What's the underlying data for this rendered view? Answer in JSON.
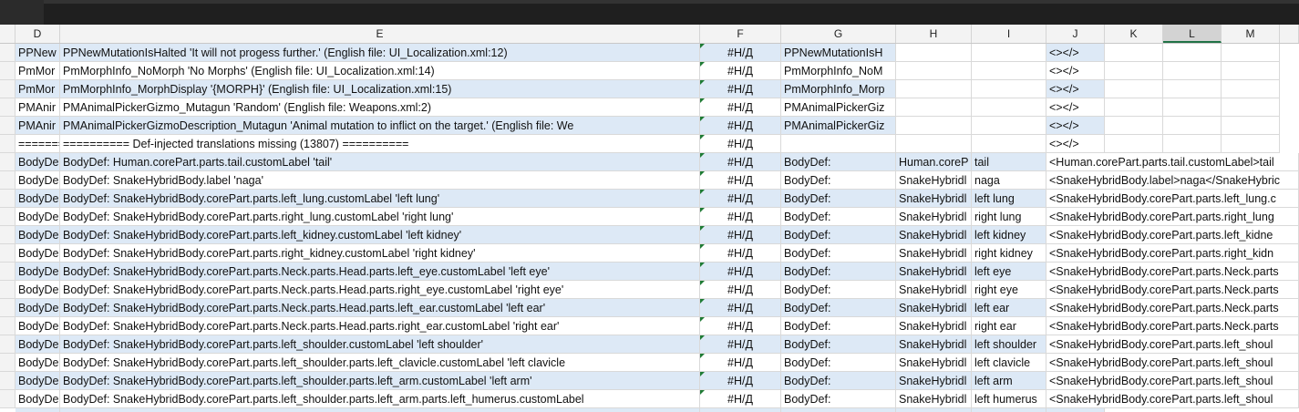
{
  "columns": [
    "D",
    "E",
    "F",
    "G",
    "H",
    "I",
    "J",
    "K",
    "L",
    "M"
  ],
  "selected_column": "L",
  "rows": [
    {
      "D": "PPNew",
      "E": "PPNewMutationIsHalted 'It will not progess further.' (English file: UI_Localization.xml:12)",
      "F": "#Н/Д",
      "G": "PPNewMutationIsH",
      "H": "",
      "I": "",
      "J": "<></>",
      "band": true
    },
    {
      "D": "PmMor",
      "E": "PmMorphInfo_NoMorph 'No Morphs' (English file: UI_Localization.xml:14)",
      "F": "#Н/Д",
      "G": "PmMorphInfo_NoM",
      "H": "",
      "I": "",
      "J": "<></>",
      "band": false
    },
    {
      "D": "PmMor",
      "E": "PmMorphInfo_MorphDisplay '{MORPH}' (English file: UI_Localization.xml:15)",
      "F": "#Н/Д",
      "G": "PmMorphInfo_Morp",
      "H": "",
      "I": "",
      "J": "<></>",
      "band": true
    },
    {
      "D": "PMAnir",
      "E": "PMAnimalPickerGizmo_Mutagun 'Random' (English file: Weapons.xml:2)",
      "F": "#Н/Д",
      "G": "PMAnimalPickerGiz",
      "H": "",
      "I": "",
      "J": "<></>",
      "band": false
    },
    {
      "D": "PMAnir",
      "E": "PMAnimalPickerGizmoDescription_Mutagun 'Animal mutation to inflict on the target.' (English file: We",
      "F": "#Н/Д",
      "G": "PMAnimalPickerGiz",
      "H": "",
      "I": "",
      "J": "<></>",
      "band": true
    },
    {
      "D": "=======",
      "E": "========== Def-injected translations missing (13807) ==========",
      "F": "#Н/Д",
      "G": "",
      "H": "",
      "I": "",
      "J": "<></>",
      "band": false
    },
    {
      "D": "BodyDe",
      "E": "BodyDef: Human.corePart.parts.tail.customLabel 'tail'",
      "F": "#Н/Д",
      "G": "BodyDef:",
      "H": "Human.coreP",
      "I": "tail",
      "J": "<Human.corePart.parts.tail.customLabel>tail",
      "band": true
    },
    {
      "D": "BodyDe",
      "E": "BodyDef: SnakeHybridBody.label 'naga'",
      "F": "#Н/Д",
      "G": "BodyDef:",
      "H": "SnakeHybridl",
      "I": "naga",
      "J": "<SnakeHybridBody.label>naga</SnakeHybric",
      "band": false
    },
    {
      "D": "BodyDe",
      "E": "BodyDef: SnakeHybridBody.corePart.parts.left_lung.customLabel 'left lung'",
      "F": "#Н/Д",
      "G": "BodyDef:",
      "H": "SnakeHybridl",
      "I": "left lung",
      "J": "<SnakeHybridBody.corePart.parts.left_lung.c",
      "band": true
    },
    {
      "D": "BodyDe",
      "E": "BodyDef: SnakeHybridBody.corePart.parts.right_lung.customLabel 'right lung'",
      "F": "#Н/Д",
      "G": "BodyDef:",
      "H": "SnakeHybridl",
      "I": "right lung",
      "J": "<SnakeHybridBody.corePart.parts.right_lung",
      "band": false
    },
    {
      "D": "BodyDe",
      "E": "BodyDef: SnakeHybridBody.corePart.parts.left_kidney.customLabel 'left kidney'",
      "F": "#Н/Д",
      "G": "BodyDef:",
      "H": "SnakeHybridl",
      "I": "left kidney",
      "J": "<SnakeHybridBody.corePart.parts.left_kidne",
      "band": true
    },
    {
      "D": "BodyDe",
      "E": "BodyDef: SnakeHybridBody.corePart.parts.right_kidney.customLabel 'right kidney'",
      "F": "#Н/Д",
      "G": "BodyDef:",
      "H": "SnakeHybridl",
      "I": "right kidney",
      "J": "<SnakeHybridBody.corePart.parts.right_kidn",
      "band": false
    },
    {
      "D": "BodyDe",
      "E": "BodyDef: SnakeHybridBody.corePart.parts.Neck.parts.Head.parts.left_eye.customLabel 'left eye'",
      "F": "#Н/Д",
      "G": "BodyDef:",
      "H": "SnakeHybridl",
      "I": "left eye",
      "J": "<SnakeHybridBody.corePart.parts.Neck.parts",
      "band": true
    },
    {
      "D": "BodyDe",
      "E": "BodyDef: SnakeHybridBody.corePart.parts.Neck.parts.Head.parts.right_eye.customLabel 'right eye'",
      "F": "#Н/Д",
      "G": "BodyDef:",
      "H": "SnakeHybridl",
      "I": "right eye",
      "J": "<SnakeHybridBody.corePart.parts.Neck.parts",
      "band": false
    },
    {
      "D": "BodyDe",
      "E": "BodyDef: SnakeHybridBody.corePart.parts.Neck.parts.Head.parts.left_ear.customLabel 'left ear'",
      "F": "#Н/Д",
      "G": "BodyDef:",
      "H": "SnakeHybridl",
      "I": "left ear",
      "J": "<SnakeHybridBody.corePart.parts.Neck.parts",
      "band": true
    },
    {
      "D": "BodyDe",
      "E": "BodyDef: SnakeHybridBody.corePart.parts.Neck.parts.Head.parts.right_ear.customLabel 'right ear'",
      "F": "#Н/Д",
      "G": "BodyDef:",
      "H": "SnakeHybridl",
      "I": "right ear",
      "J": "<SnakeHybridBody.corePart.parts.Neck.parts",
      "band": false
    },
    {
      "D": "BodyDe",
      "E": "BodyDef: SnakeHybridBody.corePart.parts.left_shoulder.customLabel 'left shoulder'",
      "F": "#Н/Д",
      "G": "BodyDef:",
      "H": "SnakeHybridl",
      "I": "left shoulder",
      "J": "<SnakeHybridBody.corePart.parts.left_shoul",
      "band": true
    },
    {
      "D": "BodyDe",
      "E": "BodyDef: SnakeHybridBody.corePart.parts.left_shoulder.parts.left_clavicle.customLabel 'left clavicle",
      "F": "#Н/Д",
      "G": "BodyDef:",
      "H": "SnakeHybridl",
      "I": "left clavicle",
      "J": "<SnakeHybridBody.corePart.parts.left_shoul",
      "band": false
    },
    {
      "D": "BodyDe",
      "E": "BodyDef: SnakeHybridBody.corePart.parts.left_shoulder.parts.left_arm.customLabel 'left arm'",
      "F": "#Н/Д",
      "G": "BodyDef:",
      "H": "SnakeHybridl",
      "I": "left arm",
      "J": "<SnakeHybridBody.corePart.parts.left_shoul",
      "band": true
    },
    {
      "D": "BodyDe",
      "E": "BodyDef: SnakeHybridBody.corePart.parts.left_shoulder.parts.left_arm.parts.left_humerus.customLabel",
      "F": "#Н/Д",
      "G": "BodyDef:",
      "H": "SnakeHybridl",
      "I": "left humerus",
      "J": "<SnakeHybridBody.corePart.parts.left_shoul",
      "band": false
    }
  ]
}
